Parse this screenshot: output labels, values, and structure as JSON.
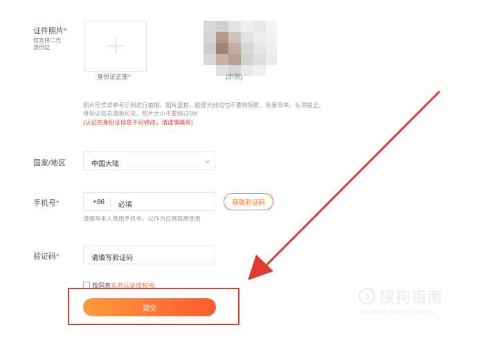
{
  "form": {
    "photo": {
      "label": "证件照片",
      "required_mark": "*",
      "sub_line1": "仅支持二代",
      "sub_line2": "身份证",
      "upload_caption": "身份证正面",
      "upload_required_mark": "*",
      "example_caption": "(示例)",
      "upload_icon": "plus-icon"
    },
    "hint": {
      "line1": "照片形式请参考示例进行拍摄，图片竖拍，脸部光线均匀不要有阴影，背景简单，头顶铂全。",
      "line2": "身份证信息清晰可见，照片大小不要超过5M",
      "warning": "(认证的身份证信息不可修改，请谨慎填写)"
    },
    "country": {
      "label": "国家/地区",
      "value": "中国大陆",
      "dropdown_icon": "chevron-down-icon"
    },
    "phone": {
      "label": "手机号",
      "required_mark": "*",
      "prefix": "+86",
      "placeholder": "必填",
      "hint": "请填写本人常用手机号，以作为日常联络使用",
      "get_code_label": "获取验证码"
    },
    "code": {
      "label": "验证码",
      "required_mark": "*",
      "placeholder": "请填写验证码"
    },
    "agree": {
      "prefix": "我同意",
      "link": "实名认证授权书"
    },
    "submit_label": "提交"
  },
  "watermark": {
    "text": "搜狗指南",
    "url": "zhinan.sogou.com"
  },
  "colors": {
    "accent": "#f07a3a",
    "required": "#e8412c",
    "annotation": "#e23a2e"
  }
}
